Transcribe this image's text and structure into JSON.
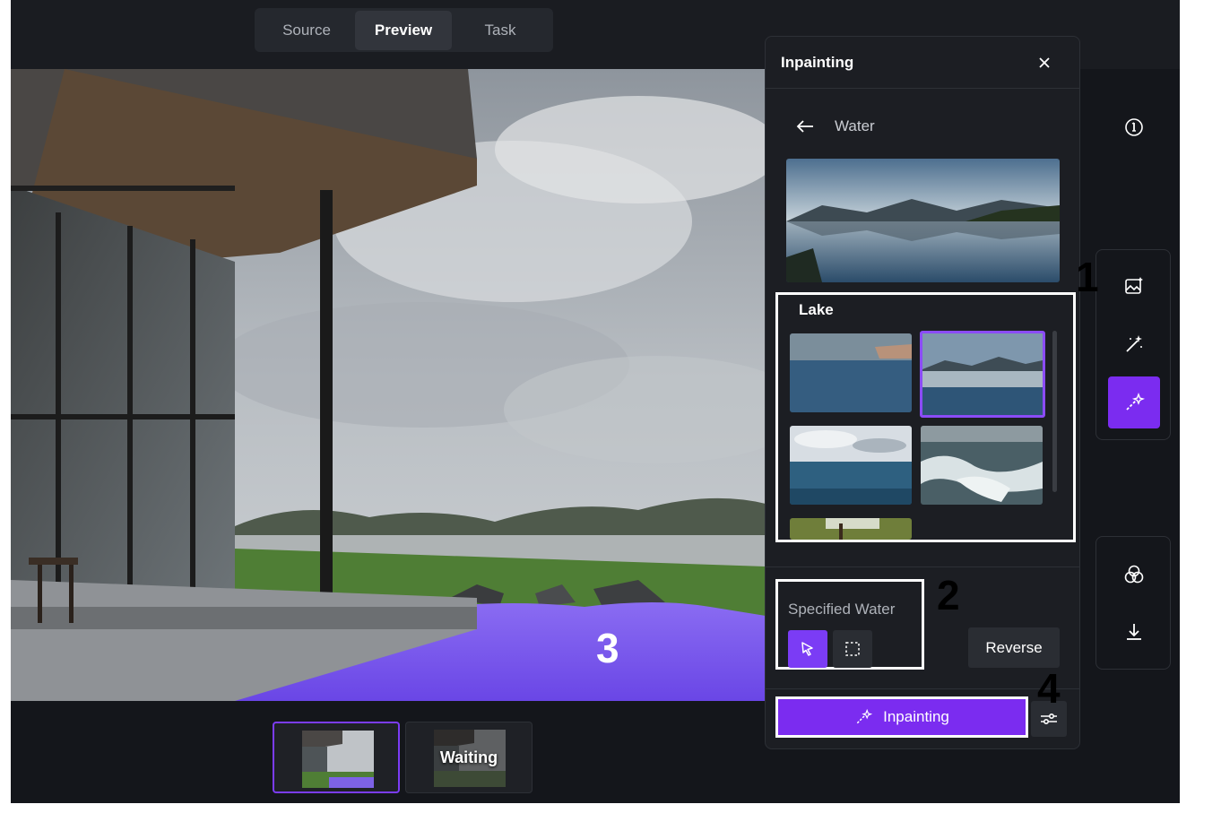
{
  "tabs": {
    "source": "Source",
    "preview": "Preview",
    "task": "Task",
    "active": "Preview"
  },
  "panel": {
    "title": "Inpainting",
    "back_label": "Water",
    "category_title": "Lake",
    "options": [
      "lake-blue",
      "lake-mountain",
      "ocean",
      "waves",
      "forest"
    ],
    "selected_option": "lake-mountain",
    "mode_label": "Specified Water",
    "reverse_label": "Reverse",
    "inpaint_label": "Inpainting"
  },
  "thumbnails": {
    "waiting_label": "Waiting"
  },
  "annotations": {
    "n1": "1",
    "n2": "2",
    "n3": "3",
    "n4": "4"
  },
  "rail": {
    "top_icon": "info-icon",
    "group1": [
      "image-sparkle-icon",
      "magic-wand-icon",
      "magic-wand-sparkle-icon"
    ],
    "group2": [
      "color-circles-icon",
      "download-icon"
    ]
  },
  "colors": {
    "accent": "#7b2cf0",
    "panel_bg": "#1c1e23",
    "app_bg": "#14161b"
  }
}
